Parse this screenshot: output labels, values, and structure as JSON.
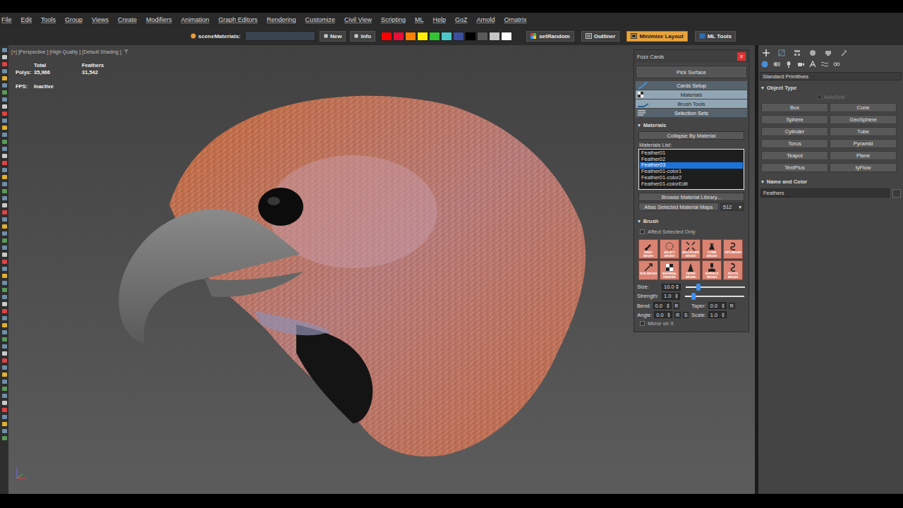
{
  "menu": [
    "File",
    "Edit",
    "Tools",
    "Group",
    "Views",
    "Create",
    "Modifiers",
    "Animation",
    "Graph Editors",
    "Rendering",
    "Customize",
    "Civil View",
    "Scripting",
    "ML",
    "Help",
    "GoZ",
    "Arnold",
    "Ornatrix"
  ],
  "toolbar": {
    "scene_label": "sceneMaterials:",
    "buttons": [
      "New",
      "Info"
    ],
    "swatches": [
      {
        "color": "#ff0000"
      },
      {
        "color": "#e8103a"
      },
      {
        "color": "#ff7f00"
      },
      {
        "color": "#ffee00"
      },
      {
        "color": "#33c333"
      },
      {
        "color": "#4ac8c8"
      },
      {
        "color": "#3b4f9e"
      },
      {
        "color": "#000000"
      },
      {
        "color": "#5a5a5a"
      },
      {
        "color": "#c4c4c4"
      },
      {
        "color": "#ffffff"
      }
    ],
    "tools": [
      {
        "label": "setRandom",
        "selected": false
      },
      {
        "label": "Outliner",
        "selected": false
      },
      {
        "label": "Minimize Layout",
        "selected": true
      },
      {
        "label": "ML Tools",
        "selected": false
      }
    ]
  },
  "viewport": {
    "label": "[+] [Perspective ] [High Quality ] [Default Shading ]",
    "stats": {
      "headers": [
        "Total",
        "Feathers"
      ],
      "polys_label": "Polys:",
      "polys": [
        "35,966",
        "31,542"
      ],
      "fps_label": "FPS:",
      "fps": "Inactive"
    }
  },
  "fuzz_cards": {
    "title": "Fuzz Cards",
    "close": "x",
    "pick_surface": "Pick Surface",
    "rollouts": [
      {
        "label": "Cards Setup",
        "selected": false
      },
      {
        "label": "Materials",
        "selected": true
      },
      {
        "label": "Brush Tools",
        "selected": true
      },
      {
        "label": "Selection Sets",
        "selected": false
      }
    ],
    "materials": {
      "toggle": "▾",
      "header": "Materials",
      "collapse_button": "Collapse By Material",
      "list_label": "Materials List:",
      "items": [
        {
          "label": "Feather01",
          "selected": false
        },
        {
          "label": "Feather02",
          "selected": false
        },
        {
          "label": "Feather03",
          "selected": true
        },
        {
          "label": "Feather01-color1",
          "selected": false
        },
        {
          "label": "Feather01-color2",
          "selected": false
        },
        {
          "label": "Feather01-colorEdit",
          "selected": false
        }
      ],
      "browse_button": "Browse Material Library...",
      "atlas_button": "Atlas Selected Material Maps",
      "atlas_size": "512",
      "atlas_arrow": "▾"
    },
    "brush": {
      "toggle": "▾",
      "header": "Brush",
      "affect_selected": {
        "label": "Affect Selected Only",
        "checked": false
      },
      "tools": [
        "PAINT BRUSH",
        "SELECT BRUSH",
        "MULTIPLIER BRUSH",
        "COMB BRUSH",
        "TIPS BRUSH",
        "SIZE BRUSH",
        "MATERIAL PAINTER",
        "TAPER BRUSH",
        "SURFACE BRUSH",
        "ROOTS BRUSH"
      ],
      "sliders": [
        {
          "label": "Size:",
          "value": "10.0",
          "level": 0.22
        },
        {
          "label": "Strength:",
          "value": "1.0",
          "level": 0.14
        }
      ],
      "params": [
        {
          "label": "Bend:",
          "value": "0.0",
          "buttons": [
            "R"
          ]
        },
        {
          "label": "Taper:",
          "value": "0.0",
          "buttons": [
            "R"
          ]
        },
        {
          "label": "Angle:",
          "value": "0.0",
          "buttons": [
            "R",
            "S"
          ]
        },
        {
          "label": "Scale:",
          "value": "1.0",
          "buttons": []
        }
      ],
      "mirror": {
        "label": "Mirror on X",
        "checked": false
      }
    }
  },
  "command_panel": {
    "category": "Standard Primitives",
    "object_type": {
      "toggle": "▾",
      "header": "Object Type",
      "autogrid": {
        "label": "AutoGrid",
        "checked": false,
        "disabled": true
      },
      "buttons": [
        "Box",
        "Cone",
        "Sphere",
        "GeoSphere",
        "Cylinder",
        "Tube",
        "Torus",
        "Pyramid",
        "Teapot",
        "Plane",
        "TextPlus",
        "tyFlow"
      ]
    },
    "name_color": {
      "toggle": "▾",
      "header": "Name and Color",
      "name": "Feathers",
      "color": "#3a3a3a"
    }
  }
}
